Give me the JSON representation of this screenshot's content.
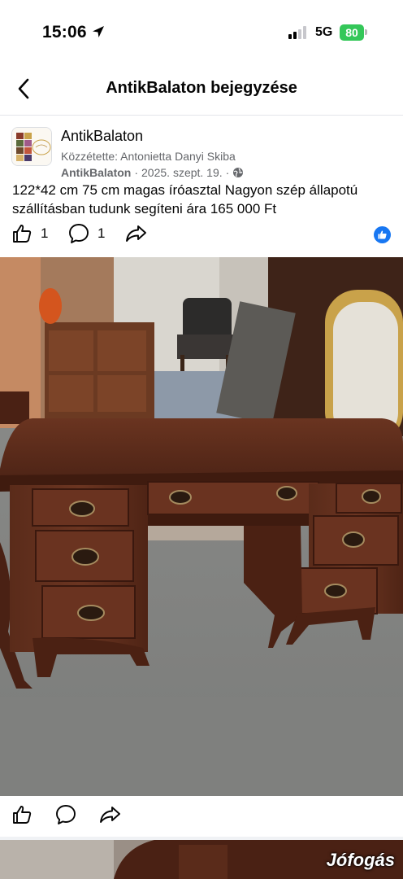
{
  "status_bar": {
    "time": "15:06",
    "network": "5G",
    "battery": "80"
  },
  "header": {
    "title": "AntikBalaton bejegyzése",
    "back_icon": "chevron-left-icon"
  },
  "post": {
    "page_name": "AntikBalaton",
    "posted_by": "Közzétette: Antonietta Danyi Skiba",
    "meta_page": "AntikBalaton",
    "date": "2025. szept. 19.",
    "separator": "·",
    "privacy_icon": "globe-icon",
    "text": "122*42 cm 75 cm magas íróasztal Nagyon szép állapotú szállításban tudunk segíteni ára 165 000 Ft",
    "likes_count": "1",
    "comments_count": "1"
  },
  "actions": {
    "like_icon": "thumbs-up-icon",
    "comment_icon": "comment-icon",
    "share_icon": "share-icon"
  },
  "photo": {
    "description_icon": "desk-photo"
  },
  "watermark": "Jófogás",
  "colors": {
    "brand_blue": "#1877f2",
    "battery_green": "#34c759",
    "muted_text": "#65676b",
    "wood": "#5a2a18"
  }
}
